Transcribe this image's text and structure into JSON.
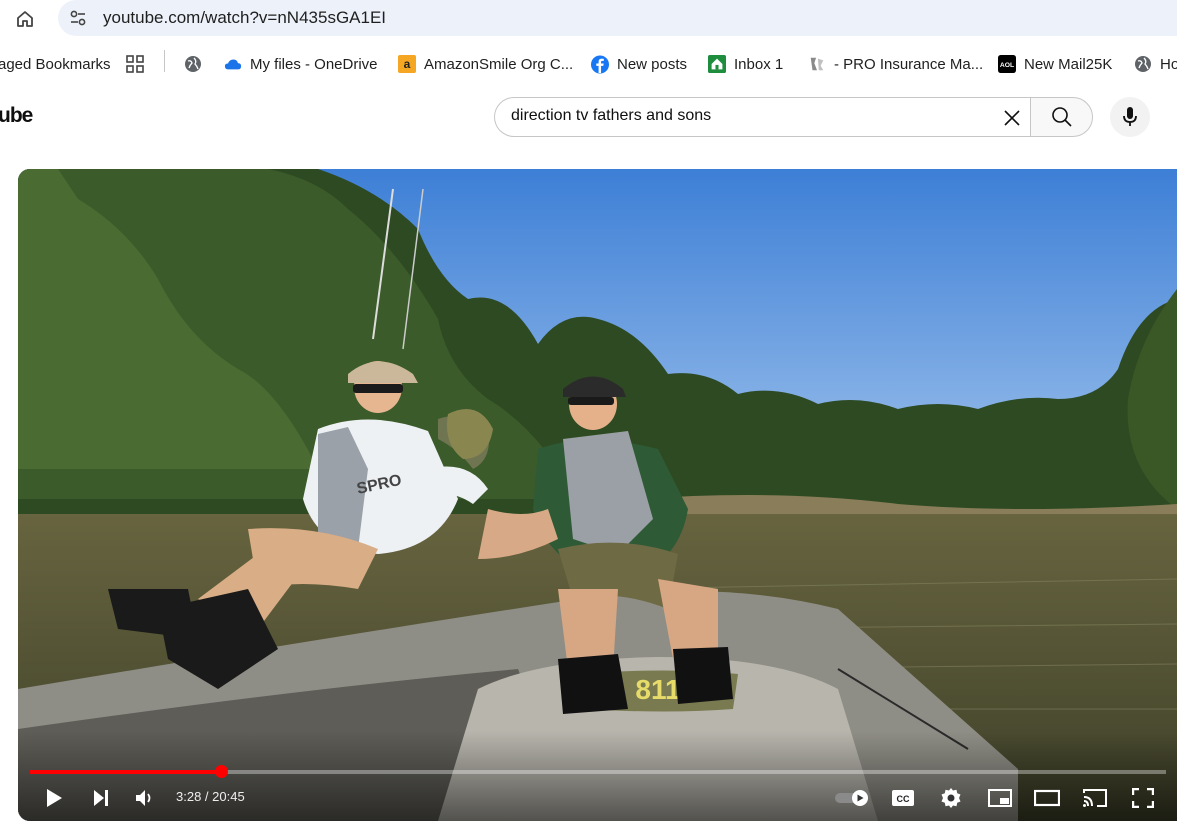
{
  "browser": {
    "url": "youtube.com/watch?v=nN435sGA1EI",
    "bookmarks": [
      {
        "label": "aged Bookmarks",
        "icon": "folder-icon"
      },
      {
        "label": "",
        "icon": "apps-grid-icon"
      },
      {
        "label": "",
        "icon": "globe-icon"
      },
      {
        "label": "My files - OneDrive",
        "icon": "onedrive-icon"
      },
      {
        "label": "AmazonSmile Org C...",
        "icon": "amazon-icon"
      },
      {
        "label": "New posts",
        "icon": "facebook-icon"
      },
      {
        "label": "Inbox 1",
        "icon": "inbox-icon"
      },
      {
        "label": "- PRO Insurance Ma...",
        "icon": "insurance-icon"
      },
      {
        "label": "New Mail25K",
        "icon": "aol-icon"
      },
      {
        "label": "Ho",
        "icon": "globe-icon"
      }
    ]
  },
  "youtube": {
    "logo_text": "ube",
    "search": {
      "value": "direction tv fathers and sons"
    }
  },
  "player": {
    "time_display": "3:28 / 20:45",
    "progress_fraction": 0.168,
    "boat_number": "811",
    "jersey_text": "SPRO",
    "colors": {
      "progress": "#ff0000",
      "sky": "#4f8fd9",
      "water": "#5a5434"
    }
  }
}
